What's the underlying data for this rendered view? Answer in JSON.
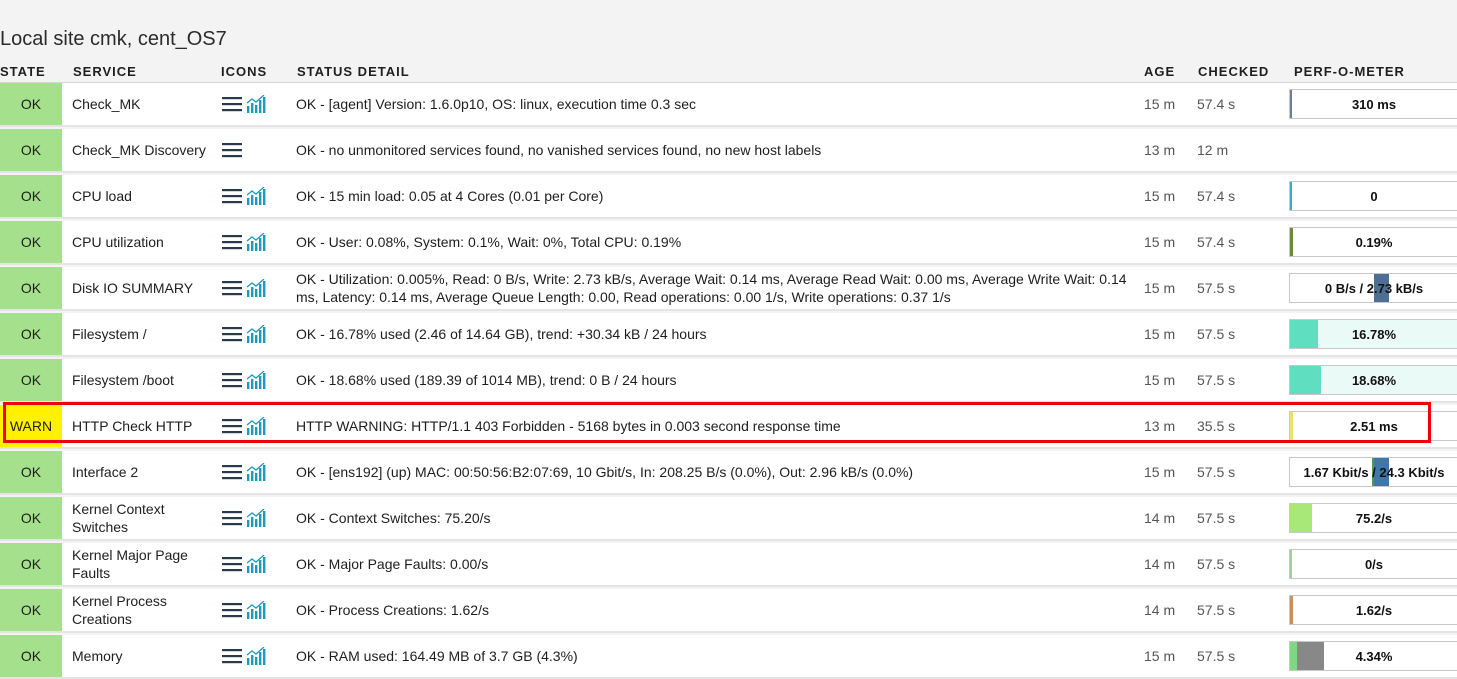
{
  "title": "Local site cmk, cent_OS7",
  "columns": {
    "state": "STATE",
    "service": "SERVICE",
    "icons": "ICONS",
    "detail": "STATUS DETAIL",
    "age": "AGE",
    "checked": "CHECKED",
    "perf": "PERF-O-METER"
  },
  "icons": {
    "menu": "hamburger-menu-icon",
    "graph": "perf-graph-icon"
  },
  "colors": {
    "ok": "#a5e08c",
    "warn": "#fff100",
    "highlight": "#f0000a"
  },
  "rows": [
    {
      "state": "OK",
      "service": "Check_MK",
      "graph": true,
      "detail": "OK - [agent] Version: 1.6.0p10, OS: linux, execution time 0.3 sec",
      "age": "15 m",
      "checked": "57.4 s",
      "perf": {
        "label": "310 ms",
        "level": 0.01,
        "color": "#6a7fa0"
      }
    },
    {
      "state": "OK",
      "service": "Check_MK Discovery",
      "graph": false,
      "detail": "OK - no unmonitored services found, no vanished services found, no new host labels",
      "age": "13 m",
      "checked": "12 m",
      "perf": null
    },
    {
      "state": "OK",
      "service": "CPU load",
      "graph": true,
      "detail": "OK - 15 min load: 0.05 at 4 Cores (0.01 per Core)",
      "age": "15 m",
      "checked": "57.4 s",
      "perf": {
        "label": "0",
        "level": 0.01,
        "color": "#40a8c0"
      }
    },
    {
      "state": "OK",
      "service": "CPU utilization",
      "graph": true,
      "detail": "OK - User: 0.08%, System: 0.1%, Wait: 0%, Total CPU: 0.19%",
      "age": "15 m",
      "checked": "57.4 s",
      "perf": {
        "label": "0.19%",
        "level": 0.02,
        "color": "#6a8a3c"
      }
    },
    {
      "state": "OK",
      "service": "Disk IO SUMMARY",
      "graph": true,
      "detail": "OK - Utilization: 0.005%, Read: 0 B/s, Write: 2.73 kB/s, Average Wait: 0.14 ms, Average Read Wait: 0.00 ms, Average Write Wait: 0.14 ms, Latency: 0.14 ms, Average Queue Length: 0.00, Read operations: 0.00 1/s, Write operations: 0.37 1/s",
      "age": "15 m",
      "checked": "57.5 s",
      "perf": {
        "label": "0 B/s / 2.73 kB/s",
        "bidir": true,
        "right_level": 0.09,
        "color": "#4d6f93"
      }
    },
    {
      "state": "OK",
      "service": "Filesystem /",
      "graph": true,
      "detail": "OK - 16.78% used (2.46 of 14.64 GB), trend: +30.34 kB / 24 hours",
      "age": "15 m",
      "checked": "57.5 s",
      "perf": {
        "label": "16.78%",
        "level": 0.1678,
        "color": "#60dfc0",
        "bg": "#eafaf6"
      }
    },
    {
      "state": "OK",
      "service": "Filesystem /boot",
      "graph": true,
      "detail": "OK - 18.68% used (189.39 of 1014 MB), trend: 0 B / 24 hours",
      "age": "15 m",
      "checked": "57.5 s",
      "perf": {
        "label": "18.68%",
        "level": 0.1868,
        "color": "#60dfc0",
        "bg": "#eafaf6"
      }
    },
    {
      "state": "WARN",
      "service": "HTTP Check HTTP",
      "graph": true,
      "detail": "HTTP WARNING: HTTP/1.1 403 Forbidden - 5168 bytes in 0.003 second response time",
      "age": "13 m",
      "checked": "35.5 s",
      "perf": {
        "label": "2.51 ms",
        "level": 0.02,
        "color": "#e8e070"
      }
    },
    {
      "state": "OK",
      "service": "Interface 2",
      "graph": true,
      "detail": "OK - [ens192] (up) MAC: 00:50:56:B2:07:69, 10 Gbit/s, In: 208.25 B/s (0.0%), Out: 2.96 kB/s (0.0%)",
      "age": "15 m",
      "checked": "57.5 s",
      "perf": {
        "label": "1.67 Kbit/s / 24.3 Kbit/s",
        "bidir": true,
        "left_level": 0.01,
        "right_level": 0.09,
        "color": "#3f77a8",
        "left_color": "#4a9a5a"
      }
    },
    {
      "state": "OK",
      "service": "Kernel Context Switches",
      "graph": true,
      "detail": "OK - Context Switches: 75.20/s",
      "age": "14 m",
      "checked": "57.5 s",
      "perf": {
        "label": "75.2/s",
        "level": 0.13,
        "color": "#a8e878"
      }
    },
    {
      "state": "OK",
      "service": "Kernel Major Page Faults",
      "graph": true,
      "detail": "OK - Major Page Faults: 0.00/s",
      "age": "14 m",
      "checked": "57.5 s",
      "perf": {
        "label": "0/s",
        "level": 0.01,
        "color": "#9ccf9c"
      }
    },
    {
      "state": "OK",
      "service": "Kernel Process Creations",
      "graph": true,
      "detail": "OK - Process Creations: 1.62/s",
      "age": "14 m",
      "checked": "57.5 s",
      "perf": {
        "label": "1.62/s",
        "level": 0.02,
        "color": "#c89060"
      }
    },
    {
      "state": "OK",
      "service": "Memory",
      "graph": true,
      "detail": "OK - RAM used: 164.49 MB of 3.7 GB (4.3%)",
      "age": "15 m",
      "checked": "57.5 s",
      "perf": {
        "label": "4.34%",
        "level": 0.2,
        "color": "#888888",
        "prefix_color": "#7ed87e",
        "prefix_level": 0.04
      }
    }
  ]
}
